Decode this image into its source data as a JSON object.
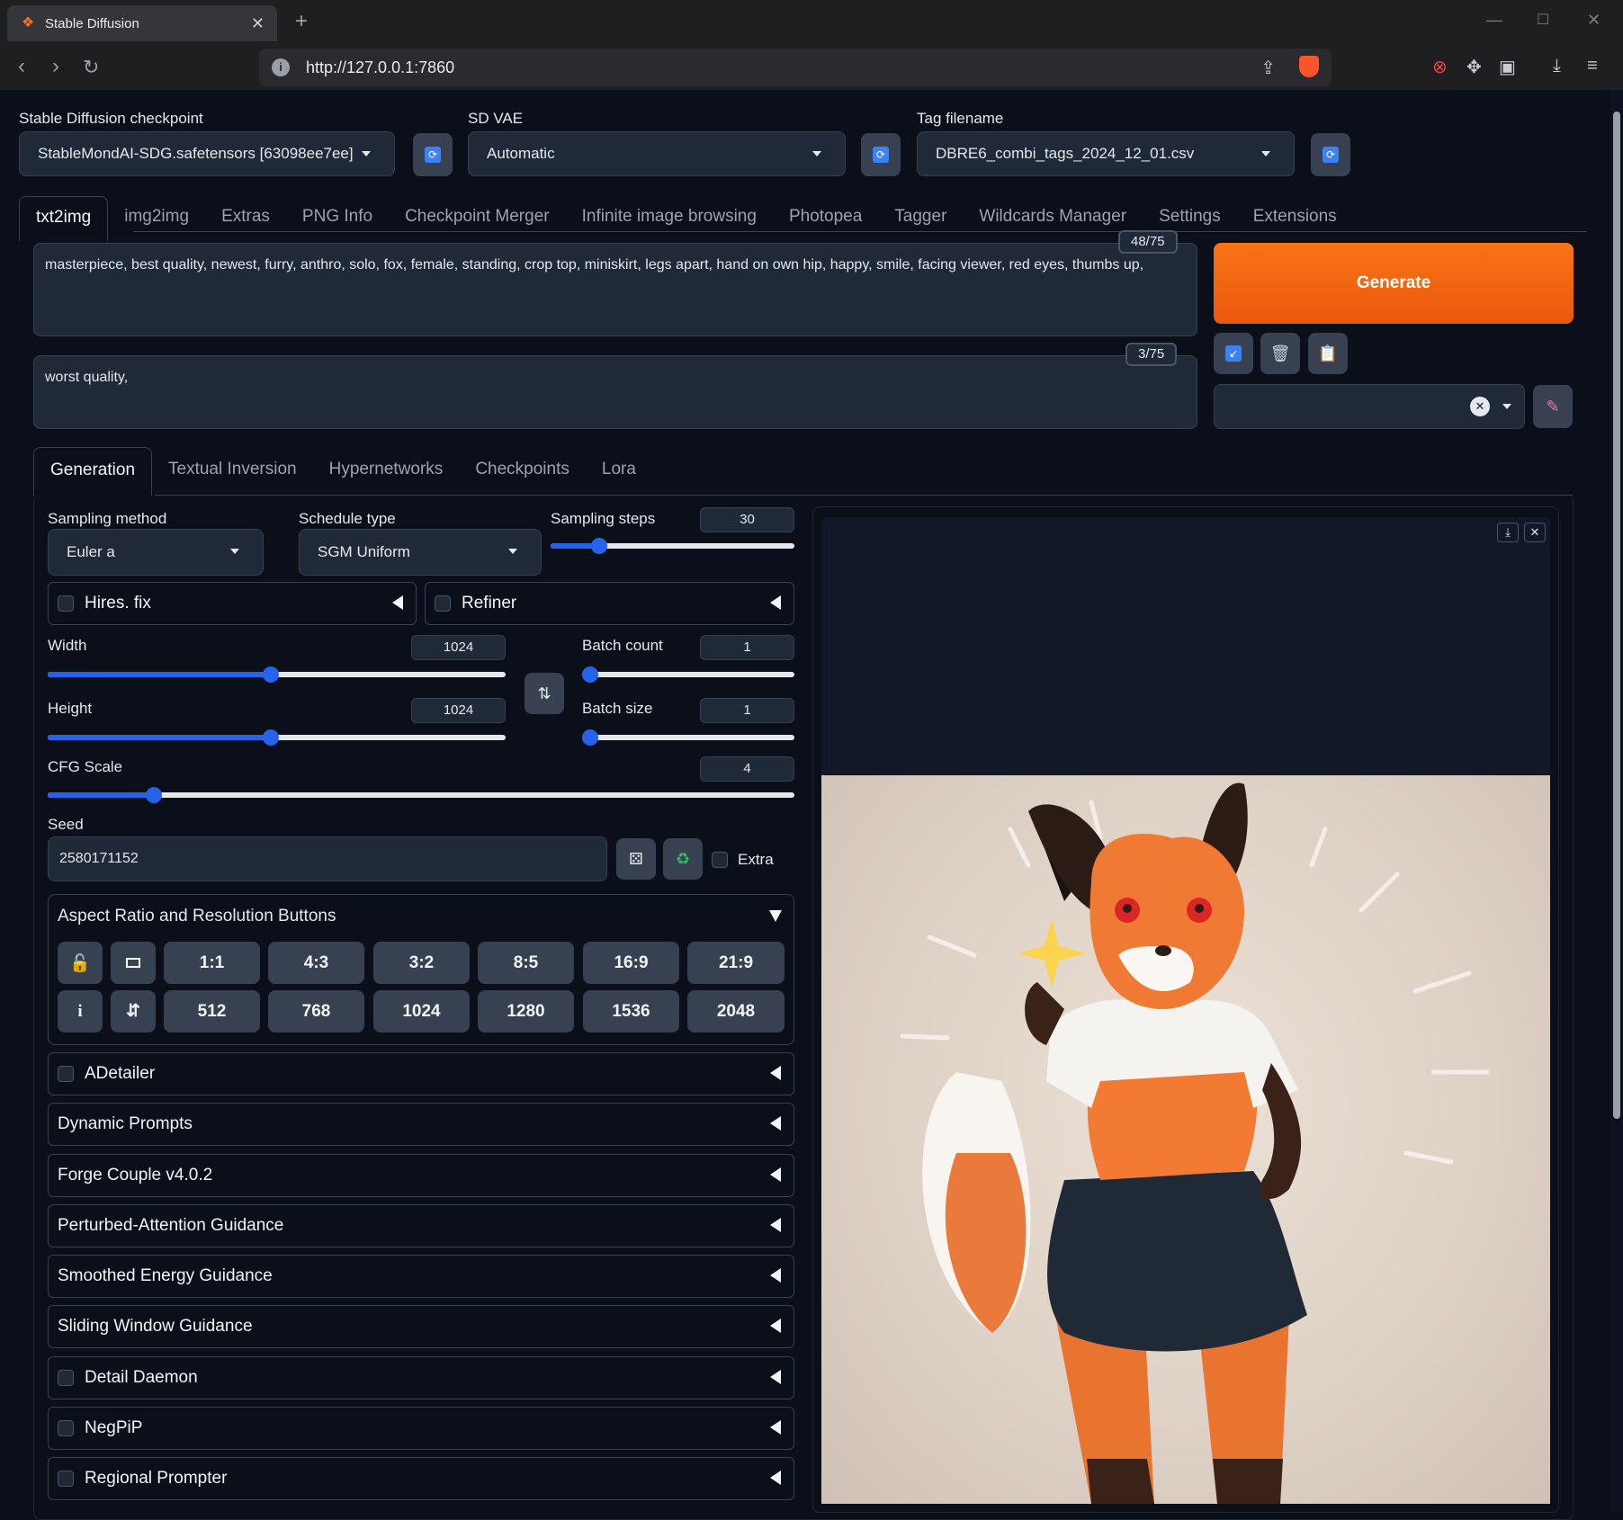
{
  "browser": {
    "tab_title": "Stable Diffusion",
    "url": "http://127.0.0.1:7860"
  },
  "top": {
    "checkpoint_label": "Stable Diffusion checkpoint",
    "checkpoint_value": "StableMondAI-SDG.safetensors [63098ee7ee]",
    "vae_label": "SD VAE",
    "vae_value": "Automatic",
    "tag_label": "Tag filename",
    "tag_value": "DBRE6_combi_tags_2024_12_01.csv"
  },
  "main_tabs": [
    "txt2img",
    "img2img",
    "Extras",
    "PNG Info",
    "Checkpoint Merger",
    "Infinite image browsing",
    "Photopea",
    "Tagger",
    "Wildcards Manager",
    "Settings",
    "Extensions"
  ],
  "prompt": {
    "positive": "masterpiece, best quality, newest, furry, anthro, solo, fox, female, standing, crop top, miniskirt, legs apart, hand on own hip, happy, smile, facing viewer, red eyes, thumbs up,",
    "positive_count": "48/75",
    "negative": "worst quality,",
    "negative_count": "3/75"
  },
  "generate_label": "Generate",
  "sub_tabs": [
    "Generation",
    "Textual Inversion",
    "Hypernetworks",
    "Checkpoints",
    "Lora"
  ],
  "generation": {
    "sampling_method_label": "Sampling method",
    "sampling_method": "Euler a",
    "schedule_type_label": "Schedule type",
    "schedule_type": "SGM Uniform",
    "sampling_steps_label": "Sampling steps",
    "sampling_steps": "30",
    "sampling_steps_fraction": 0.2,
    "hires_label": "Hires. fix",
    "refiner_label": "Refiner",
    "width_label": "Width",
    "width": "1024",
    "width_fraction": 0.487,
    "height_label": "Height",
    "height": "1024",
    "height_fraction": 0.487,
    "batch_count_label": "Batch count",
    "batch_count": "1",
    "batch_count_fraction": 0,
    "batch_size_label": "Batch size",
    "batch_size": "1",
    "batch_size_fraction": 0,
    "cfg_label": "CFG Scale",
    "cfg": "4",
    "cfg_fraction": 0.142,
    "seed_label": "Seed",
    "seed": "2580171152",
    "extra_label": "Extra"
  },
  "aspect": {
    "title": "Aspect Ratio and Resolution Buttons",
    "ratios": [
      "1:1",
      "4:3",
      "3:2",
      "8:5",
      "16:9",
      "21:9"
    ],
    "resolutions": [
      "512",
      "768",
      "1024",
      "1280",
      "1536",
      "2048"
    ],
    "info_label": "i"
  },
  "accordions": [
    {
      "label": "ADetailer",
      "checkbox": true
    },
    {
      "label": "Dynamic Prompts",
      "checkbox": false
    },
    {
      "label": "Forge Couple v4.0.2",
      "checkbox": false
    },
    {
      "label": "Perturbed-Attention Guidance",
      "checkbox": false
    },
    {
      "label": "Smoothed Energy Guidance",
      "checkbox": false
    },
    {
      "label": "Sliding Window Guidance",
      "checkbox": false
    },
    {
      "label": "Detail Daemon",
      "checkbox": true
    },
    {
      "label": "NegPiP",
      "checkbox": true
    },
    {
      "label": "Regional Prompter",
      "checkbox": true
    }
  ],
  "colors": {
    "accent": "#f97316",
    "slider": "#2563eb",
    "bg": "#0b0f19",
    "panel": "#1f2937"
  },
  "icons": [
    "refresh-icon",
    "paste-icon",
    "trash-icon",
    "clipboard-icon",
    "pencil-icon",
    "dice-icon",
    "recycle-icon",
    "lock-icon",
    "swap-icon",
    "download-icon",
    "close-icon"
  ]
}
